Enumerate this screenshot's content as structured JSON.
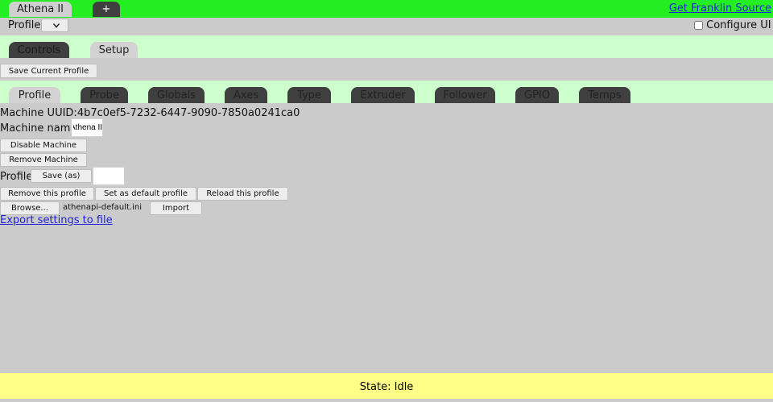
{
  "machine_tabs": [
    {
      "label": "Athena II",
      "active": true
    },
    {
      "label": "+",
      "active": false
    }
  ],
  "source_link": "Get Franklin Source",
  "profile_row": {
    "label": "Profile:",
    "select_value": "",
    "configure_label": "Configure UI",
    "configure_checked": false
  },
  "main_tabs": [
    {
      "label": "Controls",
      "active": false
    },
    {
      "label": "Setup",
      "active": true
    }
  ],
  "save_current_profile": "Save Current Profile",
  "setup_tabs": [
    {
      "label": "Profile",
      "active": true
    },
    {
      "label": "Probe",
      "active": false
    },
    {
      "label": "Globals",
      "active": false
    },
    {
      "label": "Axes",
      "active": false
    },
    {
      "label": "Type",
      "active": false
    },
    {
      "label": "Extruder",
      "active": false
    },
    {
      "label": "Follower",
      "active": false
    },
    {
      "label": "GPIO",
      "active": false
    },
    {
      "label": "Temps",
      "active": false
    }
  ],
  "profile_panel": {
    "uuid_label": "Machine UUID:",
    "uuid_value": "4b7c0ef5-7232-6447-9090-7850a0241ca0",
    "name_label": "Machine name:",
    "name_value": "Athena II",
    "disable_machine": "Disable Machine",
    "remove_machine": "Remove Machine",
    "profile_label": "Profile",
    "save_as": "Save (as)",
    "profile_name_value": "",
    "remove_profile": "Remove this profile",
    "set_default": "Set as default profile",
    "reload_profile": "Reload this profile",
    "browse": "Browse...",
    "file_name": "athenapi-default.ini",
    "import": "Import",
    "export_link": "Export settings to file"
  },
  "status": "State: Idle",
  "colors": {
    "machine_bar": "#22ee22",
    "strip": "#ccffcc",
    "status_bar": "#ffff88",
    "link": "#2222dd"
  }
}
